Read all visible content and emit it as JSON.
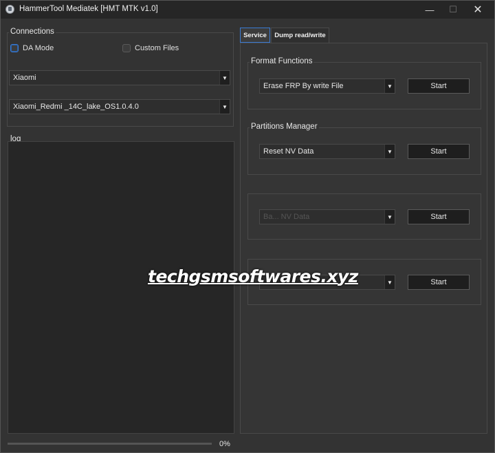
{
  "window": {
    "title": "HammerTool Mediatek [HMT MTK v1.0]",
    "controls": {
      "minimize": "—",
      "maximize": "☐",
      "close": "✕"
    }
  },
  "connections": {
    "label": "Connections",
    "da_mode_label": "DA Mode",
    "custom_files_label": "Custom Files",
    "brand_select": "Xiaomi",
    "model_select": "Xiaomi_Redmi _14C_lake_OS1.0.4.0"
  },
  "log": {
    "label": "log"
  },
  "progress": {
    "value_text": "0%",
    "value": 0
  },
  "tabs": [
    {
      "label": "Service"
    },
    {
      "label": "Dump read/write"
    }
  ],
  "service": {
    "format_functions": {
      "label": "Format Functions",
      "select": "Erase FRP By write File",
      "button": "Start"
    },
    "partitions_manager": {
      "label": "Partitions Manager",
      "select": "Reset NV Data",
      "button": "Start"
    },
    "group3": {
      "select": "Ba... NV Data",
      "button": "Start"
    },
    "group4": {
      "select": "",
      "button": "Start"
    }
  },
  "watermark": "techgsmsoftwares.xyz"
}
